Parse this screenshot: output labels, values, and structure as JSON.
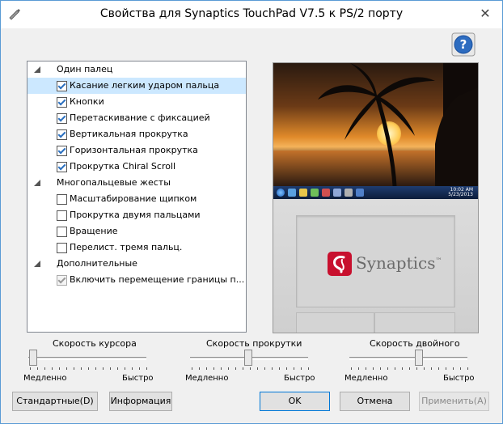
{
  "window": {
    "title": "Свойства для Synaptics TouchPad V7.5 к PS/2 порту",
    "close_glyph": "✕"
  },
  "settings_tree": {
    "groups": [
      {
        "label": "Один палец",
        "items": [
          {
            "label": "Касание легким ударом пальца",
            "checked": true,
            "selected": true
          },
          {
            "label": "Кнопки",
            "checked": true
          },
          {
            "label": "Перетаскивание с фиксацией",
            "checked": true
          },
          {
            "label": "Вертикальная прокрутка",
            "checked": true
          },
          {
            "label": "Горизонтальная прокрутка",
            "checked": true
          },
          {
            "label": "Прокрутка Chiral Scroll",
            "checked": true
          }
        ]
      },
      {
        "label": "Многопальцевые жесты",
        "items": [
          {
            "label": "Масштабирование щипком",
            "checked": false
          },
          {
            "label": "Прокрутка двумя пальцами",
            "checked": false
          },
          {
            "label": "Вращение",
            "checked": false
          },
          {
            "label": "Перелист. тремя пальц.",
            "checked": false
          }
        ]
      },
      {
        "label": "Дополнительные",
        "items": [
          {
            "label": "Включить перемещение границы п...",
            "checked": true,
            "disabled": true
          }
        ]
      }
    ]
  },
  "preview": {
    "brand": "Synaptics",
    "brand_mark": "™",
    "clock": [
      "10:02 AM",
      "5/23/2013"
    ]
  },
  "sliders": [
    {
      "caption": "Скорость курсора",
      "min_label": "Медленно",
      "max_label": "Быстро",
      "value_fraction": 0.02
    },
    {
      "caption": "Скорость прокрутки",
      "min_label": "Медленно",
      "max_label": "Быстро",
      "value_fraction": 0.47
    },
    {
      "caption": "Скорость двойного",
      "min_label": "Медленно",
      "max_label": "Быстро",
      "value_fraction": 0.57
    }
  ],
  "buttons": {
    "defaults": "Стандартные(D)",
    "info": "Информация",
    "ok": "OK",
    "cancel": "Отмена",
    "apply": "Применить(A)"
  },
  "colors": {
    "accent_border": "#5a9bd5",
    "selection": "#cce8ff",
    "synaptics_red": "#c8102e",
    "help_blue": "#2d6cc0"
  }
}
